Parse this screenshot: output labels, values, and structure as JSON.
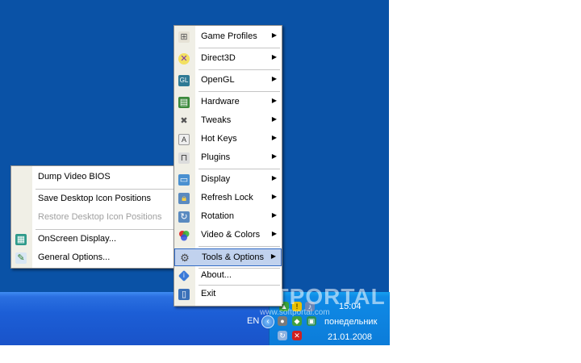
{
  "main_menu": {
    "items": [
      {
        "label": "Game Profiles",
        "icon": "gamepad-icon",
        "submenu": true
      },
      {
        "label": "Direct3D",
        "icon": "directx-icon",
        "submenu": true
      },
      {
        "label": "OpenGL",
        "icon": "opengl-icon",
        "submenu": true
      },
      {
        "label": "Hardware",
        "icon": "graphics-card-icon",
        "submenu": true
      },
      {
        "label": "Tweaks",
        "icon": "tools-icon",
        "submenu": true
      },
      {
        "label": "Hot Keys",
        "icon": "keyboard-key-icon",
        "submenu": true
      },
      {
        "label": "Plugins",
        "icon": "plugin-icon",
        "submenu": true
      },
      {
        "label": "Display",
        "icon": "monitor-icon",
        "submenu": true
      },
      {
        "label": "Refresh Lock",
        "icon": "lock-icon",
        "submenu": true
      },
      {
        "label": "Rotation",
        "icon": "rotation-icon",
        "submenu": true
      },
      {
        "label": "Video & Colors",
        "icon": "color-circles-icon",
        "submenu": true
      },
      {
        "label": "Tools & Options",
        "icon": "gear-icon",
        "submenu": true,
        "highlighted": true
      },
      {
        "label": "About...",
        "icon": "info-icon",
        "submenu": false
      },
      {
        "label": "Exit",
        "icon": "exit-door-icon",
        "submenu": false
      }
    ]
  },
  "sub_menu": {
    "items": [
      {
        "label": "Dump Video BIOS",
        "icon": "",
        "enabled": true
      },
      {
        "label": "Save Desktop Icon Positions",
        "icon": "",
        "enabled": true
      },
      {
        "label": "Restore Desktop Icon Positions",
        "icon": "",
        "enabled": false
      },
      {
        "label": "OnScreen Display...",
        "icon": "osd-icon",
        "enabled": true
      },
      {
        "label": "General Options...",
        "icon": "options-icon",
        "enabled": true
      }
    ]
  },
  "taskbar": {
    "language": "EN",
    "clock_time": "15:04",
    "clock_day": "понедельник",
    "clock_date": "21.01.2008"
  },
  "watermark": {
    "brand": "SOFTPORTAL",
    "url": "www.softportal.com"
  },
  "colors": {
    "desktop": "#0a52a6",
    "taskbar": "#1c5ed6",
    "tray": "#0c7cd9",
    "highlight": "#c1d2ee",
    "highlight_border": "#316ac5"
  }
}
